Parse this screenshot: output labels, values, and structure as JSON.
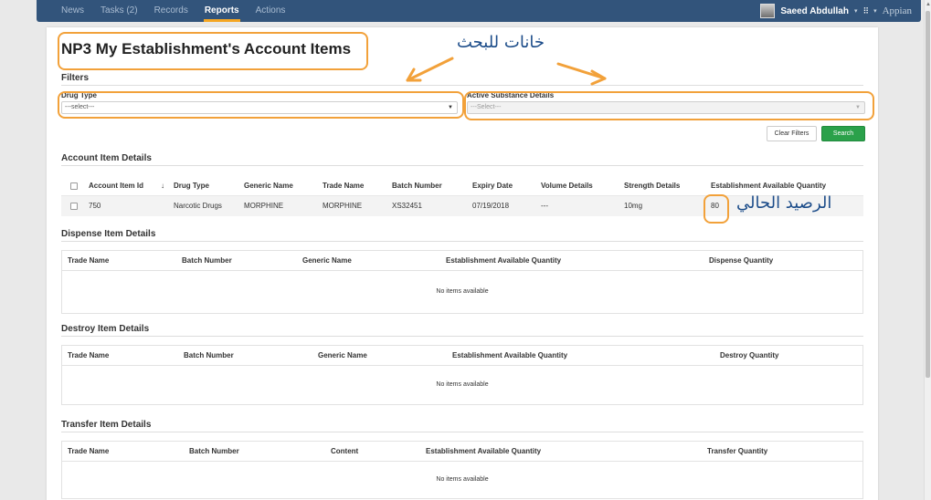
{
  "nav": {
    "items": [
      "News",
      "Tasks (2)",
      "Records",
      "Reports",
      "Actions"
    ],
    "active": "Reports"
  },
  "user": {
    "name": "Saeed Abdullah",
    "caret": "▾",
    "brand": "Appian"
  },
  "page": {
    "title": "NP3 My Establishment's Account Items"
  },
  "filters": {
    "heading": "Filters",
    "drug_type": {
      "label": "Drug Type",
      "value": "---select---"
    },
    "active_substance": {
      "label": "Active Substance Details",
      "value": "---Select---"
    },
    "clear_label": "Clear Filters",
    "search_label": "Search"
  },
  "account_items": {
    "heading": "Account Item Details",
    "columns": [
      "Account Item Id",
      "Drug Type",
      "Generic Name",
      "Trade Name",
      "Batch Number",
      "Expiry Date",
      "Volume Details",
      "Strength Details",
      "Establishment Available Quantity"
    ],
    "rows": [
      {
        "id": "750",
        "drug_type": "Narcotic Drugs",
        "generic": "MORPHINE",
        "trade": "MORPHINE",
        "batch": "XS32451",
        "expiry": "07/19/2018",
        "volume": "---",
        "strength": "10mg",
        "qty": "80"
      }
    ]
  },
  "dispense": {
    "heading": "Dispense Item Details",
    "columns": [
      "Trade Name",
      "Batch Number",
      "Generic Name",
      "Establishment Available Quantity",
      "Dispense Quantity"
    ],
    "empty": "No items available"
  },
  "destroy": {
    "heading": "Destroy Item Details",
    "columns": [
      "Trade Name",
      "Batch Number",
      "Generic Name",
      "Establishment Available Quantity",
      "Destroy Quantity"
    ],
    "empty": "No items available"
  },
  "transfer": {
    "heading": "Transfer Item Details",
    "columns": [
      "Trade Name",
      "Batch Number",
      "Content",
      "Establishment Available Quantity",
      "Transfer Quantity"
    ],
    "empty": "No items available"
  },
  "annotations": {
    "search_fields": "خانات للبحث",
    "current_balance": "الرصيد الحالي",
    "color": "#f2a13a"
  },
  "icons": {
    "sort": "sort-desc-icon",
    "apps": "apps-grid-icon",
    "dropdown": "chevron-down-icon"
  }
}
